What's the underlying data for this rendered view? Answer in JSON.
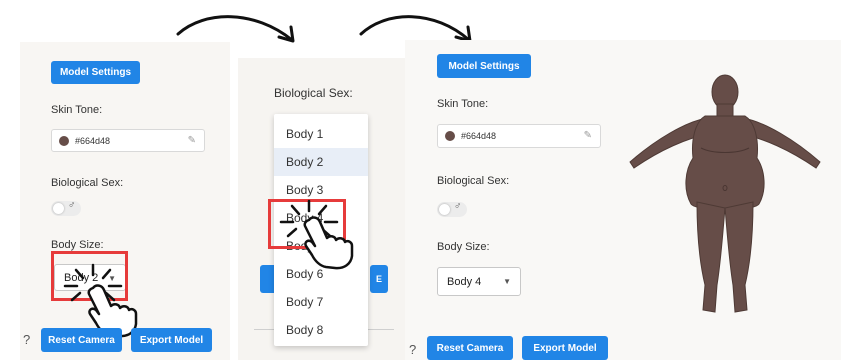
{
  "step1": {
    "model_settings": "Model Settings",
    "skin_tone_label": "Skin Tone:",
    "skin_tone_value": "#664d48",
    "bio_sex_label": "Biological Sex:",
    "bio_sex_icon": "male-symbol",
    "body_size_label": "Body Size:",
    "body_size_value": "Body 2",
    "help": "?",
    "reset_camera": "Reset Camera",
    "export_model": "Export Model"
  },
  "step2": {
    "bio_sex_label": "Biological Sex:",
    "options": [
      "Body 1",
      "Body 2",
      "Body 3",
      "Body 4",
      "Body 5",
      "Body 6",
      "Body 7",
      "Body 8"
    ],
    "selected": "Body 2",
    "clicked": "Body 4"
  },
  "step3": {
    "model_settings": "Model Settings",
    "skin_tone_label": "Skin Tone:",
    "skin_tone_value": "#664d48",
    "bio_sex_label": "Biological Sex:",
    "body_size_label": "Body Size:",
    "body_size_value": "Body 4",
    "help": "?",
    "reset_camera": "Reset Camera",
    "export_model": "Export Model"
  },
  "colors": {
    "accent": "#2185e6",
    "skin": "#664d48",
    "highlight": "#e63b3b"
  }
}
